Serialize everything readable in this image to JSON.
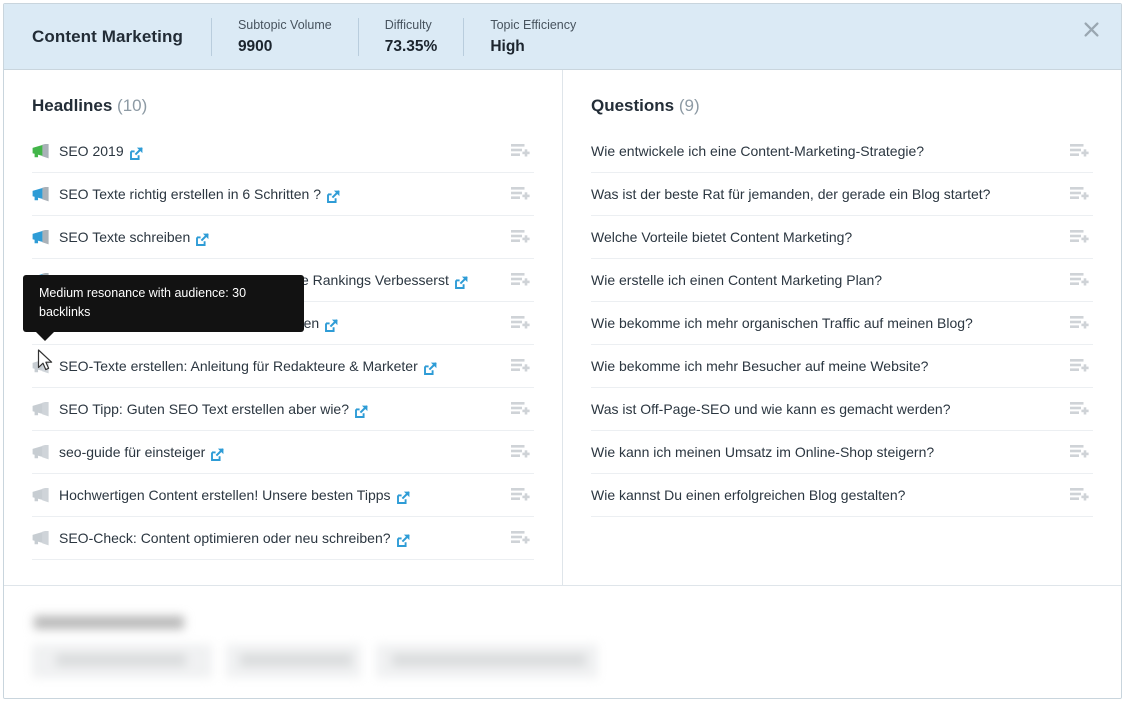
{
  "header": {
    "title": "Content Marketing",
    "metrics": [
      {
        "label": "Subtopic Volume",
        "value": "9900"
      },
      {
        "label": "Difficulty",
        "value": "73.35%"
      },
      {
        "label": "Topic Efficiency",
        "value": "High"
      }
    ],
    "close_icon": "close-icon"
  },
  "headlines": {
    "title": "Headlines",
    "count": "(10)",
    "items": [
      {
        "text": "SEO 2019",
        "megaphone": "green",
        "link": true
      },
      {
        "text": "SEO Texte richtig erstellen in 6 Schritten ?",
        "megaphone": "blue",
        "link": true
      },
      {
        "text": "SEO Texte schreiben",
        "megaphone": "blue",
        "link": true
      },
      {
        "text": "SEO Copywriting: Wie Du Deine Google Rankings Verbesserst",
        "megaphone": "blue",
        "link": true
      },
      {
        "text": "SEO und Content: Was Sie wissen sollten",
        "megaphone": "blue",
        "link": true
      },
      {
        "text": "SEO-Texte erstellen: Anleitung für Redakteure & Marketer",
        "megaphone": "grey",
        "link": true
      },
      {
        "text": "SEO Tipp: Guten SEO Text erstellen aber wie?",
        "megaphone": "grey",
        "link": true
      },
      {
        "text": "seo-guide für einsteiger",
        "megaphone": "grey",
        "link": true
      },
      {
        "text": "Hochwertigen Content erstellen! Unsere besten Tipps",
        "megaphone": "grey",
        "link": true
      },
      {
        "text": "SEO-Check: Content optimieren oder neu schreiben?",
        "megaphone": "grey",
        "link": true
      }
    ]
  },
  "questions": {
    "title": "Questions",
    "count": "(9)",
    "items": [
      {
        "text": "Wie entwickele ich eine Content-Marketing-Strategie?"
      },
      {
        "text": "Was ist der beste Rat für jemanden, der gerade ein Blog startet?"
      },
      {
        "text": "Welche Vorteile bietet Content Marketing?"
      },
      {
        "text": "Wie erstelle ich einen Content Marketing Plan?"
      },
      {
        "text": "Wie bekomme ich mehr organischen Traffic auf meinen Blog?"
      },
      {
        "text": "Wie bekomme ich mehr Besucher auf meine Website?"
      },
      {
        "text": "Was ist Off-Page-SEO und wie kann es gemacht werden?"
      },
      {
        "text": "Wie kann ich meinen Umsatz im Online-Shop steigern?"
      },
      {
        "text": "Wie kannst Du einen erfolgreichen Blog gestalten?"
      }
    ]
  },
  "tooltip": {
    "text": "Medium resonance with audience: 30 backlinks"
  },
  "icons": {
    "megaphone": "megaphone-icon",
    "external_link": "external-link-icon",
    "add_to_list": "add-to-list-icon",
    "cursor": "mouse-cursor"
  },
  "colors": {
    "header_bg": "#dbeaf5",
    "accent_blue": "#2e9cd6",
    "megaphone_green": "#42b549",
    "megaphone_grey": "#c7cdd2",
    "text": "#2b3640",
    "muted": "#8d9aa4",
    "tooltip_bg": "#121212"
  },
  "footer": {
    "redacted": true
  }
}
